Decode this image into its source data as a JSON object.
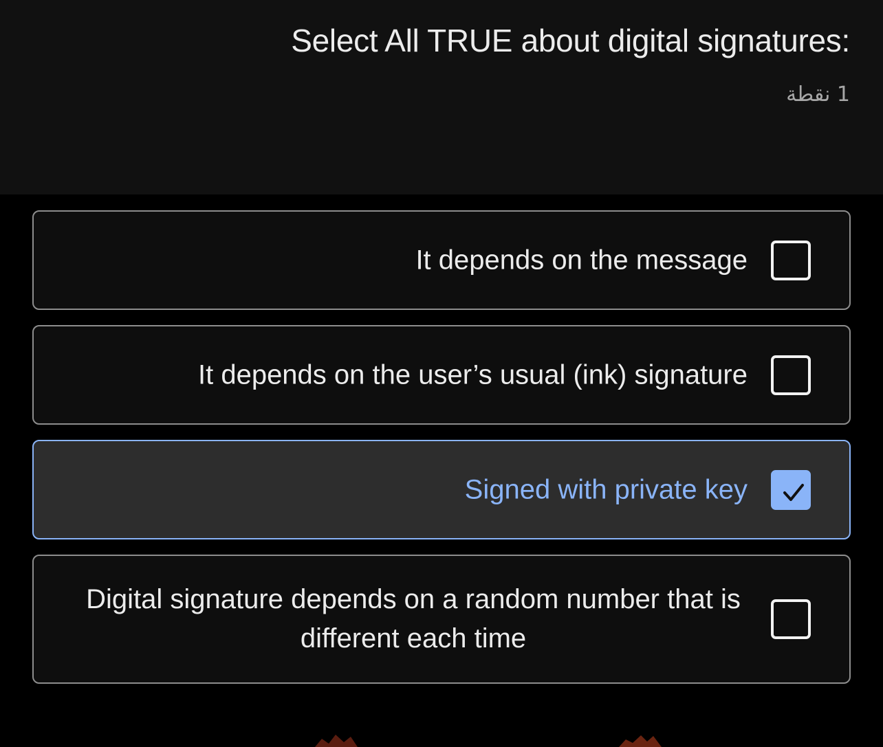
{
  "question": {
    "title": "Select All TRUE about digital signatures:",
    "points": "1 نقطة"
  },
  "options": [
    {
      "label": "It depends on the message",
      "checked": false
    },
    {
      "label": "It depends on the user’s usual (ink) signature",
      "checked": false
    },
    {
      "label": "Signed with private key",
      "checked": true
    },
    {
      "label": "Digital signature depends on a random number that is different each time",
      "checked": false
    }
  ],
  "colors": {
    "accent": "#8ab4f8",
    "header_background": "#111111",
    "page_background": "#000000",
    "option_border": "#8d8d8d",
    "selected_background": "#2d2d2d"
  },
  "icons": {
    "checkbox_checked": "checkmark-icon"
  }
}
